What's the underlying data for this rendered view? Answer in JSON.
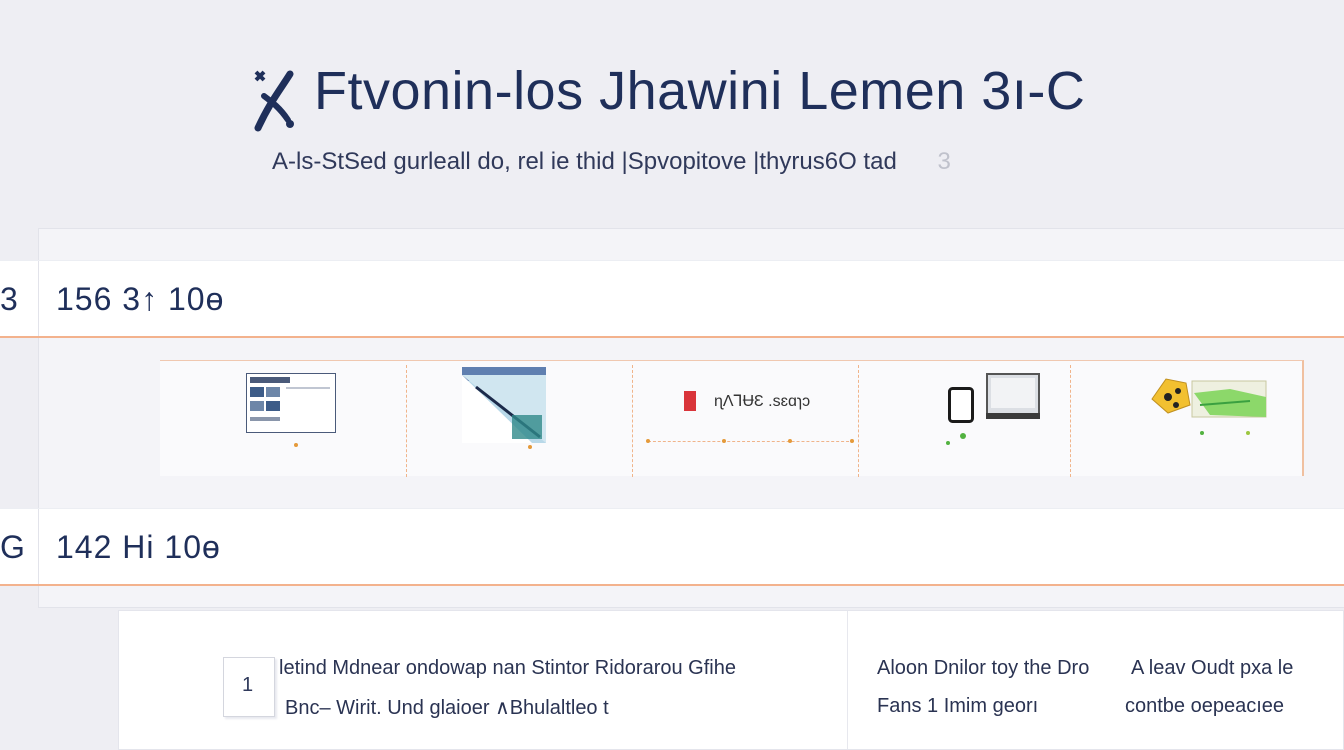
{
  "header": {
    "title": "Ftvonin-los Jhawini Lemen 3ı-C",
    "subtitle": "A-ls-StSed gurleall do, rel ie thid |Spvopitove |thyrus6O tad",
    "subtitle_extra": "3"
  },
  "rows": [
    {
      "index": "3",
      "value": "156 3↑ 10ɵ"
    },
    {
      "index": "G",
      "value": "142 Hi 10ɵ"
    }
  ],
  "strip": {
    "brand_text": "ɳɅ⅂ɄƐ .sɛɑɿɔ"
  },
  "bottom": {
    "checkbox_label": "1",
    "left_line1_a": "letind Mdnear ondowap nan Stintor",
    "left_line1_b": "Ridorarou Gfihe",
    "left_line2": "Bnc– Wirit. Und glaioer ∧Bhulaltleo t",
    "right_line1_a": "Aloon Dnilor toy the Dro",
    "right_line1_b": "A leav Oudt pxa le",
    "right_line2_a": "Fans 1 Imim georı",
    "right_line2_b": "contbe oepeacıee"
  },
  "colors": {
    "title": "#1f2f5a",
    "accent_orange": "#f3b28d",
    "brand_red": "#d9343a",
    "green": "#52b240"
  }
}
